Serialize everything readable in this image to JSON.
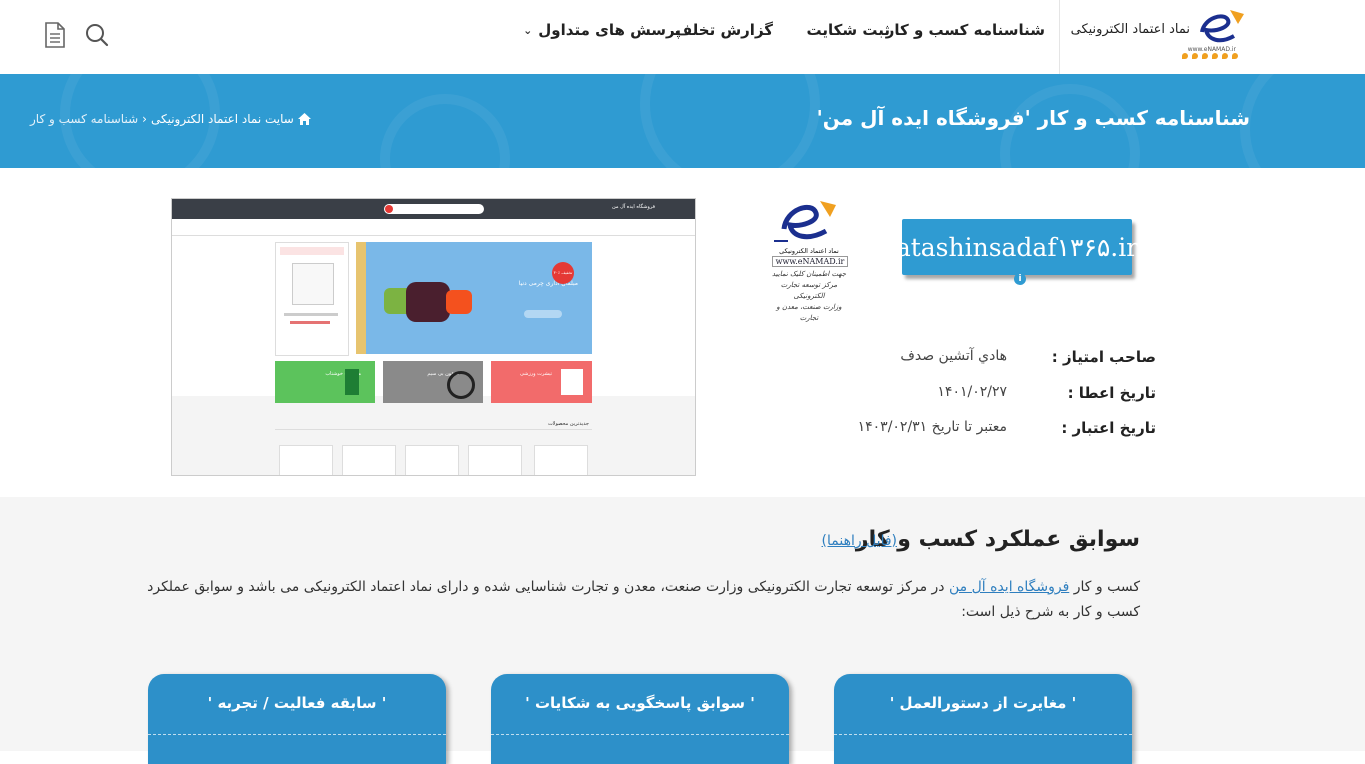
{
  "header": {
    "logo_text": "نماد اعتماد الکترونیکی",
    "logo_sub": "www.eNAMAD.ir",
    "nav": [
      "شناسنامه کسب و کار",
      "ثبت شکایت",
      "گزارش تخلف",
      "پرسش های متداول"
    ]
  },
  "banner": {
    "title": "شناسنامه کسب و کار 'فروشگاه ایده آل من'",
    "breadcrumb_home": "سایت نماد اعتماد الکترونیکی",
    "breadcrumb_sep": "›",
    "breadcrumb_current": "شناسنامه کسب و کار"
  },
  "business": {
    "domain": "atashinsadaf۱۳۶۵.ir",
    "badge_line1": "نماد اعتماد الکترونیکی",
    "badge_line2": "www.eNAMAD.ir",
    "badge_line3": "جهت اطمینان کلیک نمایید\nمرکز توسعه تجارت الکترونیکی\nوزارت صنعت، معدن و تجارت",
    "owner_label": "صاحب امتیاز :",
    "owner_value": "هادي آتشين صدف",
    "issue_label": "تاريخ اعطا :",
    "issue_value": "۱۴۰۱/۰۲/۲۷",
    "valid_label": "تاريخ اعتبار :",
    "valid_value": "معتبر تا تاريخ ۱۴۰۳/۰۲/۳۱"
  },
  "site_preview": {
    "store_name": "فروشگاه ایده آل من",
    "hero_text": "مبلمان اداری چرمی دنیا",
    "hero_badge": "۳۰٪ تخفیف",
    "section_label": "جدیدترین محصولات",
    "tile_green": "میانست خوشتاب",
    "tile_gray": "هدفون بی سیم",
    "tile_red": "تیشرت ورزشی"
  },
  "performance": {
    "title": "سوابق عملکرد کسب و کار",
    "guide_link": "(فایل راهنما)",
    "desc_prefix": "کسب و کار",
    "desc_link": "فروشگاه ایده آل من",
    "desc_suffix": "در مرکز توسعه تجارت الکترونیکی وزارت صنعت، معدن و تجارت شناسایی شده و دارای نماد اعتماد الکترونیکی می باشد و سوابق عملکرد کسب و کار به شرح ذیل است:",
    "cards": [
      "' مغایرت از دستورالعمل '",
      "' سوابق پاسخگویی به شکایات '",
      "' سابقه فعالیت / تجربه '"
    ]
  },
  "colors": {
    "accent": "#2f9bd2",
    "card": "#2d90c9",
    "link": "#2f7fbf"
  }
}
